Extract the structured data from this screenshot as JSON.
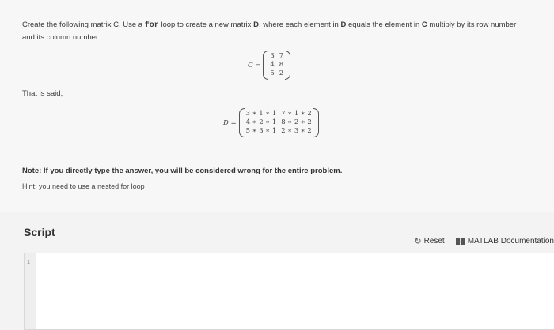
{
  "problem": {
    "prompt_1": "Create the following matrix C. Use a ",
    "prompt_code": "for",
    "prompt_2": " loop to create a new matrix ",
    "prompt_D1": "D",
    "prompt_3": ", where each element in ",
    "prompt_D2": "D",
    "prompt_4": " equals the element in ",
    "prompt_C": "C",
    "prompt_5": " multiply by its row number",
    "prompt_line2": "and its column number.",
    "c_label": "C =",
    "c_matrix": [
      [
        "3",
        "7"
      ],
      [
        "4",
        "8"
      ],
      [
        "5",
        "2"
      ]
    ],
    "that_is": "That is said,",
    "d_label": "D =",
    "d_matrix": [
      [
        "3 ∗ 1 ∗ 1",
        "7 ∗ 1 ∗ 2"
      ],
      [
        "4 ∗ 2 ∗ 1",
        "8 ∗ 2 ∗ 2"
      ],
      [
        "5 ∗ 3 ∗ 1",
        "2 ∗ 3 ∗ 2"
      ]
    ],
    "note": "Note: If you directly type the answer, you will be considered wrong for the entire problem.",
    "hint": "Hint: you need to use a nested for loop"
  },
  "script": {
    "title": "Script",
    "reset_label": "Reset",
    "reset_icon": "reset-icon",
    "docs_label": "MATLAB Documentation",
    "docs_icon": "book-icon",
    "line_numbers": [
      "1"
    ]
  }
}
